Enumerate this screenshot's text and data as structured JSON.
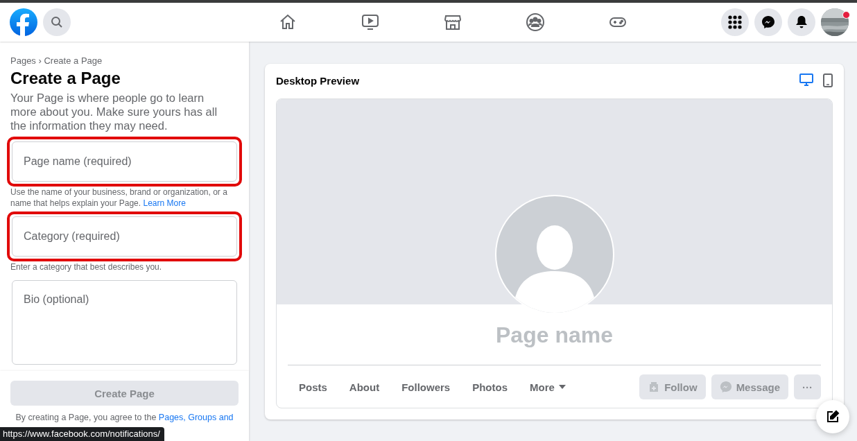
{
  "top_bar": {
    "nav": [
      {
        "kind": "home"
      },
      {
        "kind": "watch"
      },
      {
        "kind": "marketplace"
      },
      {
        "kind": "groups"
      },
      {
        "kind": "gaming"
      }
    ],
    "actions": [
      {
        "kind": "menu"
      },
      {
        "kind": "messenger"
      },
      {
        "kind": "notifications"
      }
    ],
    "avatar": {
      "kind": "picture",
      "badge": true
    }
  },
  "sidebar": {
    "breadcrumb": "Pages › Create a Page",
    "title": "Create a Page",
    "intro": "Your Page is where people go to learn more about you. Make sure yours has all the information they may need.",
    "fields": [
      {
        "kind": "input",
        "placeholder": "Page name (required)",
        "highlighted": true,
        "help": "Use the name of your business, brand or organization, or a name that helps explain your Page.",
        "help_link": "Learn More"
      },
      {
        "kind": "input",
        "placeholder": "Category (required)",
        "highlighted": true,
        "help": "Enter a category that best describes you."
      },
      {
        "kind": "textarea",
        "placeholder": "Bio (optional)",
        "highlighted": false
      }
    ],
    "create_button": {
      "label": "Create Page",
      "disabled": true
    },
    "terms": "By creating a Page, you agree to the",
    "terms_link": "Pages, Groups and"
  },
  "preview": {
    "title": "Desktop Preview",
    "modes": [
      {
        "kind": "desktop",
        "selected": true
      },
      {
        "kind": "mobile",
        "selected": false
      }
    ],
    "page_name": "Page name",
    "tabs": [
      {
        "label": "Posts",
        "dropdown": false
      },
      {
        "label": "About",
        "dropdown": false
      },
      {
        "label": "Followers",
        "dropdown": false
      },
      {
        "label": "Photos",
        "dropdown": false
      },
      {
        "label": "More",
        "dropdown": true
      }
    ],
    "buttons": [
      {
        "kind": "follow",
        "label": "Follow"
      },
      {
        "kind": "message",
        "label": "Message"
      },
      {
        "kind": "more",
        "label": "···"
      }
    ]
  },
  "status_url": "https://www.facebook.com/notifications/"
}
